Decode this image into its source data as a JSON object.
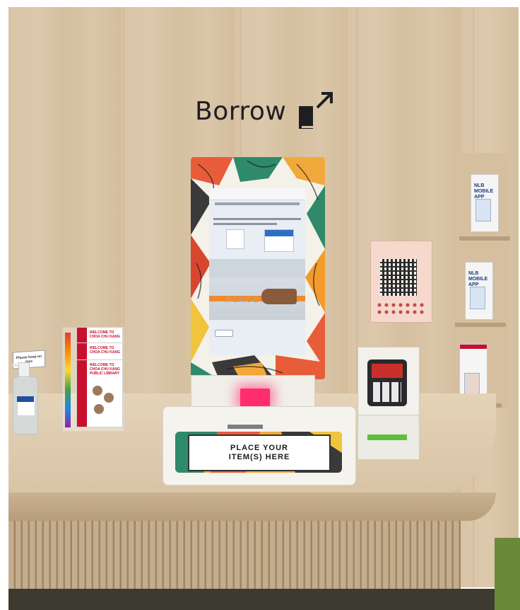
{
  "sign": {
    "text": "Borrow",
    "icon": "book-arrow-icon"
  },
  "kiosk": {
    "screen_text": "PLACE",
    "mat_line1": "PLACE YOUR",
    "mat_line2": "ITEM(S)  HERE"
  },
  "shelf": {
    "book1_title": "NLB MOBILE APP",
    "book2_title": "NLB MOBILE APP"
  },
  "brochures": {
    "item1": "WELCOME TO CHOA CHU KANG",
    "item2": "WELCOME TO CHOA CHU KANG",
    "item3": "WELCOME TO CHOA CHU KANG PUBLIC LIBRARY"
  },
  "tent_card": "Please keep on /use"
}
